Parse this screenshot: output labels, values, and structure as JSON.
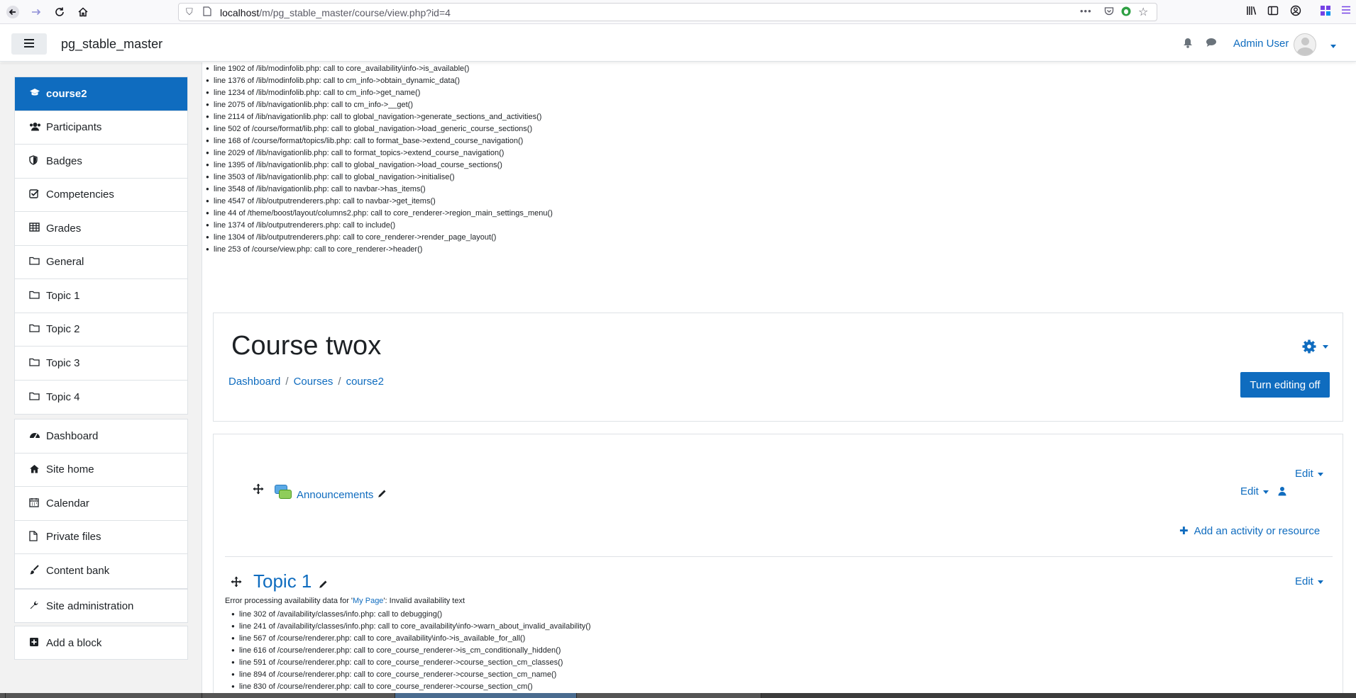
{
  "browser": {
    "url_host": "localhost",
    "url_path": "/m/pg_stable_master/course/view.php?id=4"
  },
  "navbar": {
    "site_name": "pg_stable_master",
    "user_name": "Admin User"
  },
  "drawer": {
    "course_items": [
      {
        "label": "course2",
        "icon": "graduation-cap-icon"
      },
      {
        "label": "Participants",
        "icon": "users-icon"
      },
      {
        "label": "Badges",
        "icon": "shield-icon"
      },
      {
        "label": "Competencies",
        "icon": "check-square-icon"
      },
      {
        "label": "Grades",
        "icon": "table-icon"
      },
      {
        "label": "General",
        "icon": "folder-icon"
      },
      {
        "label": "Topic 1",
        "icon": "folder-icon"
      },
      {
        "label": "Topic 2",
        "icon": "folder-icon"
      },
      {
        "label": "Topic 3",
        "icon": "folder-icon"
      },
      {
        "label": "Topic 4",
        "icon": "folder-icon"
      }
    ],
    "site_items": [
      {
        "label": "Dashboard",
        "icon": "tachometer-icon"
      },
      {
        "label": "Site home",
        "icon": "home-icon"
      },
      {
        "label": "Calendar",
        "icon": "calendar-icon"
      },
      {
        "label": "Private files",
        "icon": "file-icon"
      },
      {
        "label": "Content bank",
        "icon": "paint-brush-icon"
      }
    ],
    "admin_label": "Site administration",
    "add_block_label": "Add a block"
  },
  "debug_trace": [
    "line 1902 of /lib/modinfolib.php: call to core_availability\\info->is_available()",
    "line 1376 of /lib/modinfolib.php: call to cm_info->obtain_dynamic_data()",
    "line 1234 of /lib/modinfolib.php: call to cm_info->get_name()",
    "line 2075 of /lib/navigationlib.php: call to cm_info->__get()",
    "line 2114 of /lib/navigationlib.php: call to global_navigation->generate_sections_and_activities()",
    "line 502 of /course/format/lib.php: call to global_navigation->load_generic_course_sections()",
    "line 168 of /course/format/topics/lib.php: call to format_base->extend_course_navigation()",
    "line 2029 of /lib/navigationlib.php: call to format_topics->extend_course_navigation()",
    "line 1395 of /lib/navigationlib.php: call to global_navigation->load_course_sections()",
    "line 3503 of /lib/navigationlib.php: call to global_navigation->initialise()",
    "line 3548 of /lib/navigationlib.php: call to navbar->has_items()",
    "line 4547 of /lib/outputrenderers.php: call to navbar->get_items()",
    "line 44 of /theme/boost/layout/columns2.php: call to core_renderer->region_main_settings_menu()",
    "line 1374 of /lib/outputrenderers.php: call to include()",
    "line 1304 of /lib/outputrenderers.php: call to core_renderer->render_page_layout()",
    "line 253 of /course/view.php: call to core_renderer->header()"
  ],
  "header": {
    "course_title": "Course twox",
    "breadcrumb": [
      "Dashboard",
      "Courses",
      "course2"
    ],
    "breadcrumb_sep": "/",
    "editing_button": "Turn editing off"
  },
  "course": {
    "edit_label": "Edit",
    "activity_name": "Announcements",
    "add_activity_label": "Add an activity or resource",
    "topic1_title": "Topic 1",
    "error_prefix": "Error processing availability data for '",
    "error_link": "My Page",
    "error_suffix": "': Invalid availability text",
    "trace2": [
      "line 302 of /availability/classes/info.php: call to debugging()",
      "line 241 of /availability/classes/info.php: call to core_availability\\info->warn_about_invalid_availability()",
      "line 567 of /course/renderer.php: call to core_availability\\info->is_available_for_all()",
      "line 616 of /course/renderer.php: call to core_course_renderer->is_cm_conditionally_hidden()",
      "line 591 of /course/renderer.php: call to core_course_renderer->course_section_cm_classes()",
      "line 894 of /course/renderer.php: call to core_course_renderer->course_section_cm_name()",
      "line 830 of /course/renderer.php: call to core_course_renderer->course_section_cm()"
    ]
  },
  "colors": {
    "primary": "#0f6cbf",
    "drawer_bg": "#f2f2f2"
  }
}
